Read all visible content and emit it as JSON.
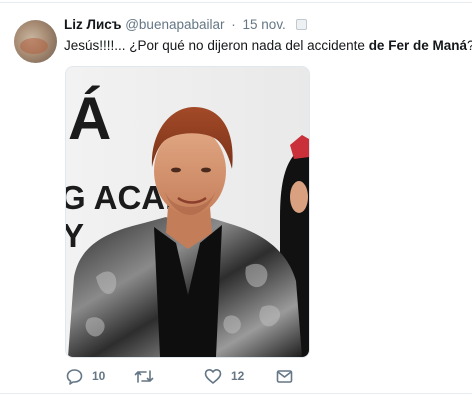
{
  "tweet": {
    "author_name": "Liz Лисъ",
    "handle": "@buenapabailar",
    "separator": "·",
    "date": "15 nov.",
    "text_before": "Jesús!!!!... ¿Por qué no dijeron nada del accidente ",
    "text_bold": "de Fer de Maná",
    "text_after": "?",
    "emoji": "see-no-evil-monkey-icon"
  },
  "photo": {
    "backdrop_letters": [
      "Á",
      "G ACAD",
      "Y"
    ]
  },
  "actions": {
    "reply_count": "10",
    "retweet_count": "",
    "like_count": "12",
    "icons": [
      "reply-icon",
      "retweet-icon",
      "like-icon",
      "message-icon"
    ]
  },
  "colors": {
    "text": "#14171a",
    "muted": "#657786",
    "divider": "#e6ecf0"
  }
}
